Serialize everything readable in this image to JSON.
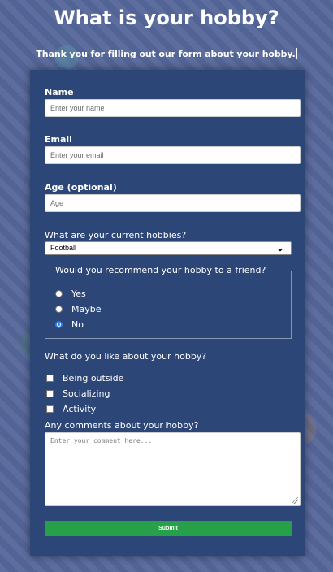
{
  "page": {
    "title": "What is your hobby?",
    "subtitle": "Thank you for filling out our form about your hobby."
  },
  "form": {
    "name": {
      "label": "Name",
      "placeholder": "Enter your name",
      "value": ""
    },
    "email": {
      "label": "Email",
      "placeholder": "Enter your email",
      "value": ""
    },
    "age": {
      "label": "Age (optional)",
      "placeholder": "Age",
      "value": ""
    },
    "hobbies": {
      "label": "What are your current hobbies?",
      "selected": "Football"
    },
    "recommend": {
      "legend": "Would you recommend your hobby to a friend?",
      "options": [
        {
          "label": "Yes",
          "checked": false
        },
        {
          "label": "Maybe",
          "checked": false
        },
        {
          "label": "No",
          "checked": true
        }
      ]
    },
    "likes": {
      "label": "What do you like about your hobby?",
      "options": [
        {
          "label": "Being outside",
          "checked": false
        },
        {
          "label": "Socializing",
          "checked": false
        },
        {
          "label": "Activity",
          "checked": false
        }
      ]
    },
    "comments": {
      "label": "Any comments about your hobby?",
      "placeholder": "Enter your comment here..."
    },
    "submit_label": "Submit"
  },
  "colors": {
    "background": "#55679a",
    "card": "#2c4677",
    "submit": "#26a049",
    "radio_checked": "#2f7de1"
  },
  "icons": {
    "select_arrow": "chevron-down-icon",
    "textarea_resize": "resize-handle-icon"
  }
}
